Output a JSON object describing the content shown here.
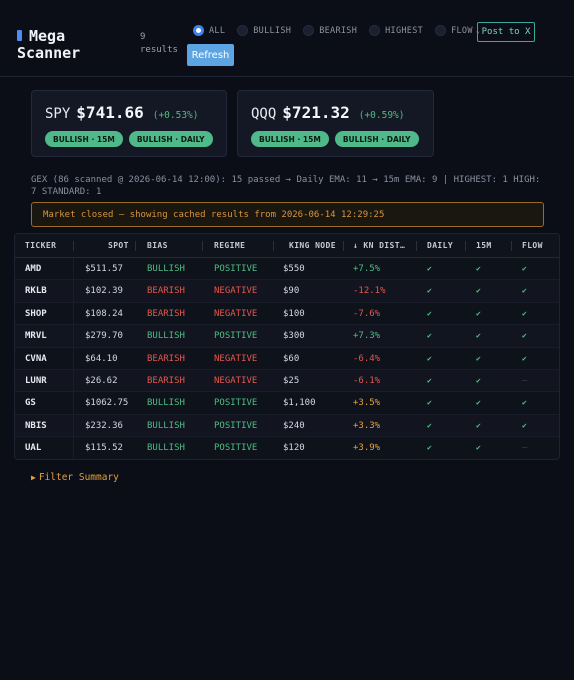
{
  "header": {
    "logo_line1": "Mega",
    "logo_line2": "Scanner",
    "results_count": "9",
    "results_label": "results",
    "filters": [
      {
        "label": "ALL",
        "active": true
      },
      {
        "label": "BULLISH",
        "active": false
      },
      {
        "label": "BEARISH",
        "active": false
      },
      {
        "label": "HIGHEST",
        "active": false
      },
      {
        "label": "FLOW",
        "active": false,
        "dropdown": true
      }
    ],
    "refresh_label": "Refresh",
    "post_label": "Post to X"
  },
  "cards": [
    {
      "symbol": "SPY",
      "price": "$741.66",
      "change": "(+0.53%)",
      "badges": [
        "BULLISH · 15M",
        "BULLISH · DAILY"
      ]
    },
    {
      "symbol": "QQQ",
      "price": "$721.32",
      "change": "(+0.59%)",
      "badges": [
        "BULLISH · 15M",
        "BULLISH · DAILY"
      ]
    }
  ],
  "gex_line": "GEX (86 scanned @ 2026-06-14 12:00): 15 passed → Daily EMA: 11 → 15m EMA: 9 | HIGHEST: 1 HIGH: 7 STANDARD: 1",
  "notice": "Market closed — showing cached results from 2026-06-14 12:29:25",
  "table": {
    "columns": [
      "TICKER",
      "SPOT",
      "BIAS",
      "REGIME",
      "KING NODE",
      "↓ KN DIST…",
      "DAILY",
      "15M",
      "FLOW"
    ],
    "rows": [
      {
        "ticker": "AMD",
        "spot": "$511.57",
        "bias": "BULLISH",
        "regime": "POSITIVE",
        "king": "$550",
        "kn": "+7.5%",
        "daily": "✔",
        "m15": "✔",
        "flow": "✔"
      },
      {
        "ticker": "RKLB",
        "spot": "$102.39",
        "bias": "BEARISH",
        "regime": "NEGATIVE",
        "king": "$90",
        "kn": "-12.1%",
        "daily": "✔",
        "m15": "✔",
        "flow": "✔"
      },
      {
        "ticker": "SHOP",
        "spot": "$108.24",
        "bias": "BEARISH",
        "regime": "NEGATIVE",
        "king": "$100",
        "kn": "-7.6%",
        "daily": "✔",
        "m15": "✔",
        "flow": "✔"
      },
      {
        "ticker": "MRVL",
        "spot": "$279.70",
        "bias": "BULLISH",
        "regime": "POSITIVE",
        "king": "$300",
        "kn": "+7.3%",
        "daily": "✔",
        "m15": "✔",
        "flow": "✔"
      },
      {
        "ticker": "CVNA",
        "spot": "$64.10",
        "bias": "BEARISH",
        "regime": "NEGATIVE",
        "king": "$60",
        "kn": "-6.4%",
        "daily": "✔",
        "m15": "✔",
        "flow": "✔"
      },
      {
        "ticker": "LUNR",
        "spot": "$26.62",
        "bias": "BEARISH",
        "regime": "NEGATIVE",
        "king": "$25",
        "kn": "-6.1%",
        "daily": "✔",
        "m15": "✔",
        "flow": "—"
      },
      {
        "ticker": "GS",
        "spot": "$1062.75",
        "bias": "BULLISH",
        "regime": "POSITIVE",
        "king": "$1,100",
        "kn": "+3.5%",
        "daily": "✔",
        "m15": "✔",
        "flow": "✔"
      },
      {
        "ticker": "NBIS",
        "spot": "$232.36",
        "bias": "BULLISH",
        "regime": "POSITIVE",
        "king": "$240",
        "kn": "+3.3%",
        "daily": "✔",
        "m15": "✔",
        "flow": "✔"
      },
      {
        "ticker": "UAL",
        "spot": "$115.52",
        "bias": "BULLISH",
        "regime": "POSITIVE",
        "king": "$120",
        "kn": "+3.9%",
        "daily": "✔",
        "m15": "✔",
        "flow": "—"
      }
    ]
  },
  "summary_label": "Filter Summary",
  "colors": {
    "bullish": "#4ebc82",
    "bearish": "#e4574e",
    "accent": "#3b82f6",
    "amber": "#e7a23e"
  }
}
